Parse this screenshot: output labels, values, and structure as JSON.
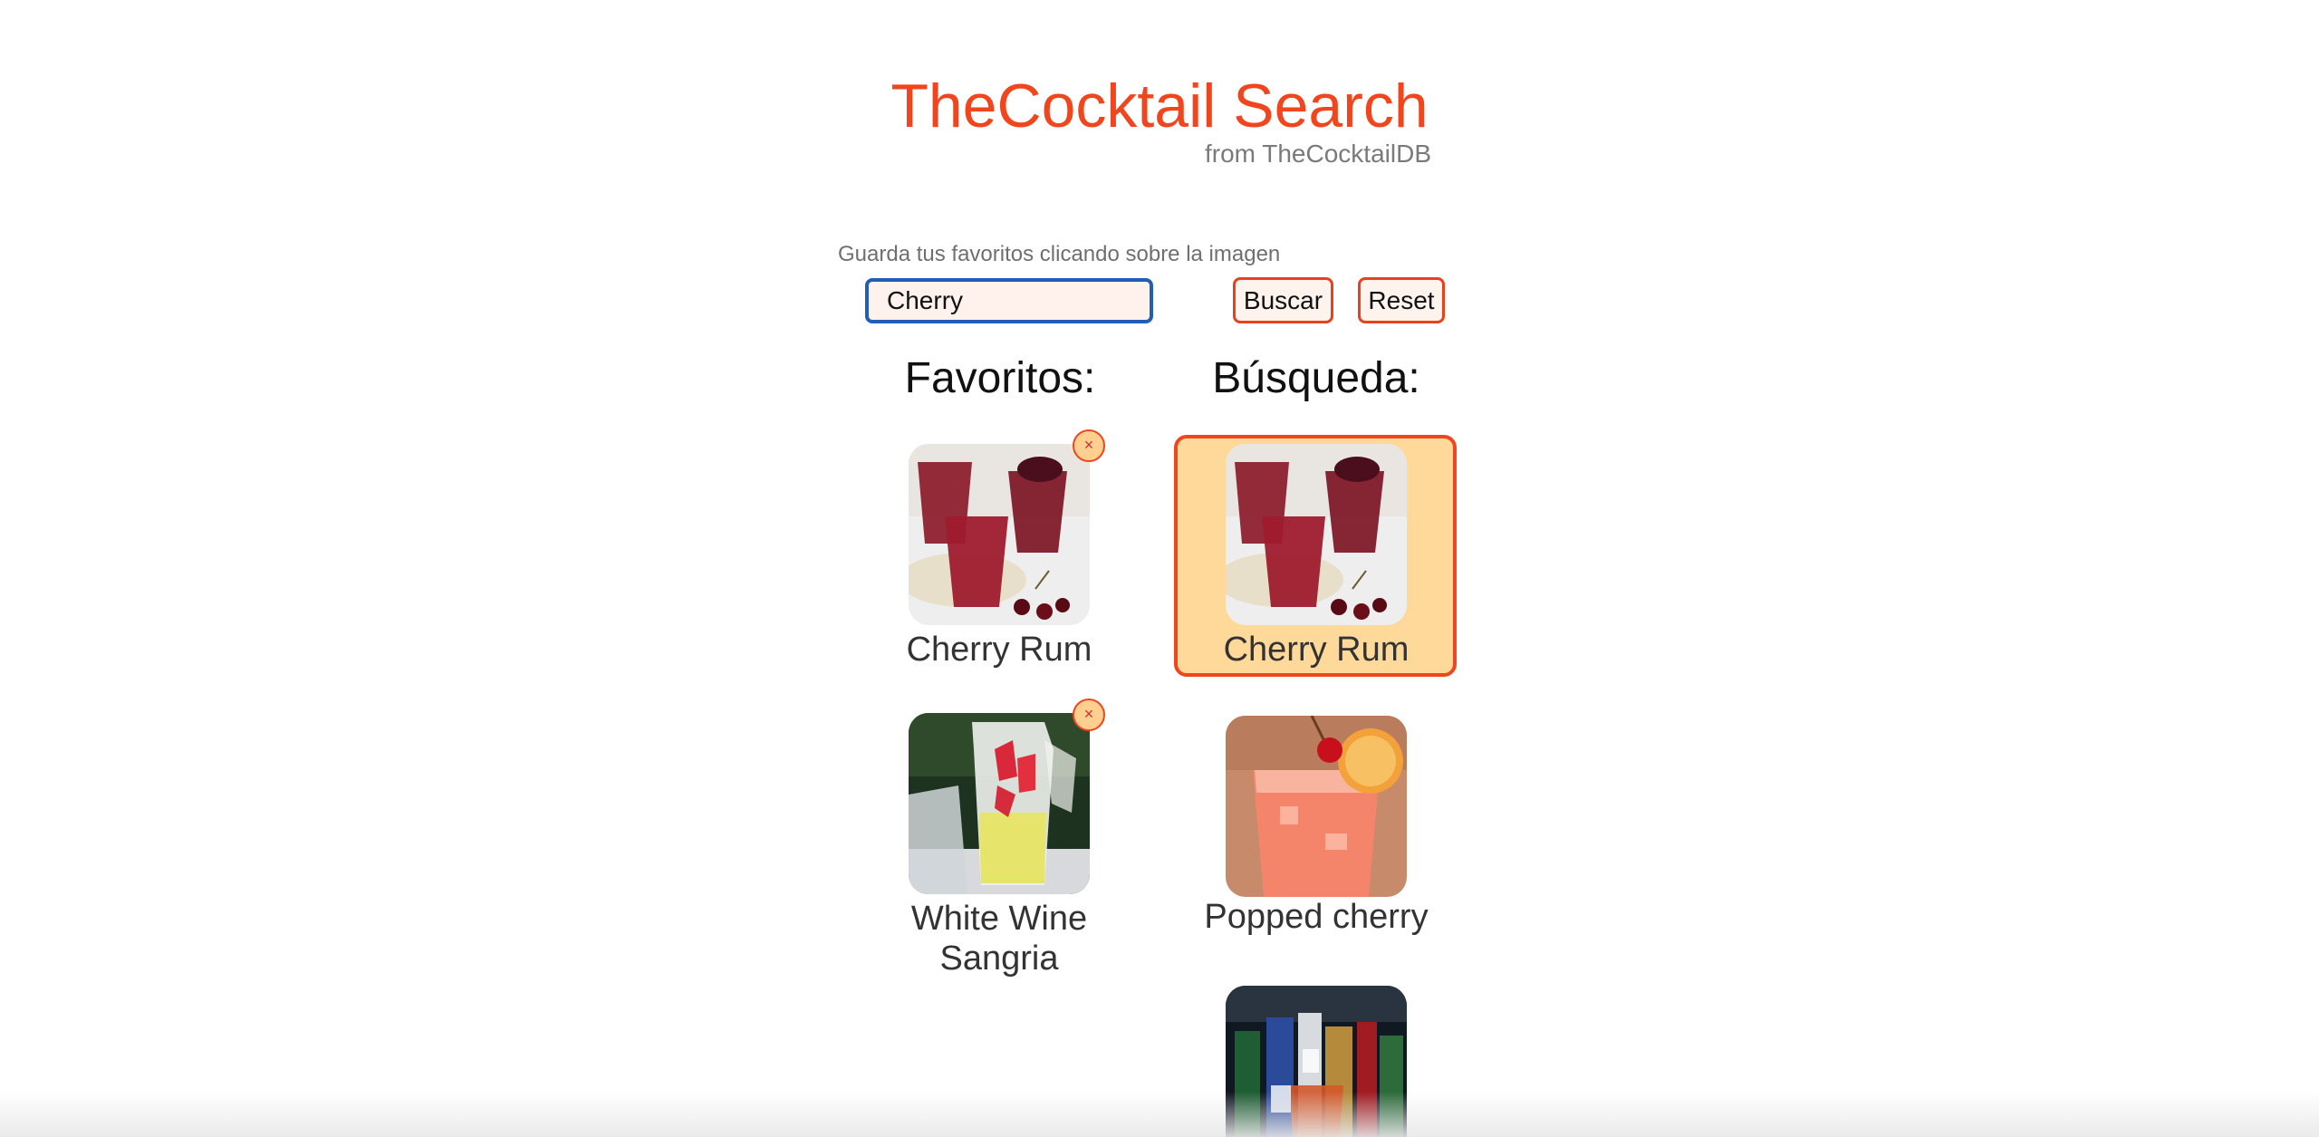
{
  "header": {
    "title": "TheCocktail Search",
    "subtitle": "from TheCocktailDB"
  },
  "search": {
    "hint": "Guarda tus favoritos clicando sobre la imagen",
    "value": "Cherry",
    "buscar_label": "Buscar",
    "reset_label": "Reset"
  },
  "favorites": {
    "heading": "Favoritos:",
    "items": [
      {
        "name": "Cherry Rum",
        "remove_label": "×"
      },
      {
        "name": "White Wine Sangria",
        "remove_label": "×"
      }
    ]
  },
  "results": {
    "heading": "Búsqueda:",
    "items": [
      {
        "name": "Cherry Rum",
        "selected": true
      },
      {
        "name": "Popped cherry",
        "selected": false
      },
      {
        "name": "",
        "selected": false
      }
    ]
  },
  "colors": {
    "accent": "#f0451d",
    "selected_bg": "#ffd99a",
    "input_border": "#1f5fb8"
  }
}
